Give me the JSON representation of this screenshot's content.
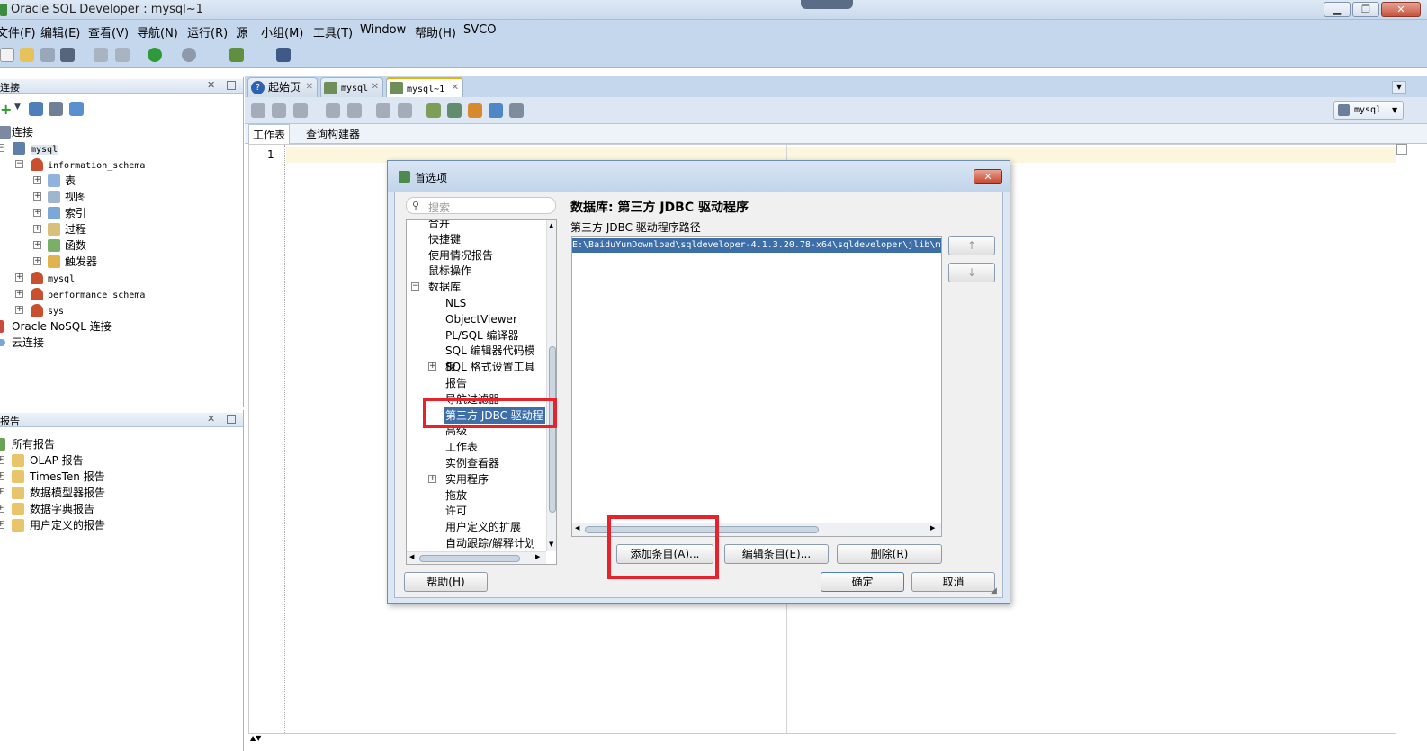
{
  "window": {
    "title": "Oracle SQL Developer : mysql~1",
    "min": "▁",
    "max": "❐",
    "close": "✕"
  },
  "menubar": [
    "文件(F)",
    "编辑(E)",
    "查看(V)",
    "导航(N)",
    "运行(R)",
    "源",
    "小组(M)",
    "工具(T)",
    "Window",
    "帮助(H)",
    "SVCO"
  ],
  "connections_panel": {
    "title": "连接",
    "root": "连接",
    "items": [
      {
        "label": "mysql",
        "level": 1
      },
      {
        "label": "information_schema",
        "level": 2
      },
      {
        "label": "表",
        "level": 3
      },
      {
        "label": "视图",
        "level": 3
      },
      {
        "label": "索引",
        "level": 3
      },
      {
        "label": "过程",
        "level": 3
      },
      {
        "label": "函数",
        "level": 3
      },
      {
        "label": "触发器",
        "level": 3
      },
      {
        "label": "mysql",
        "level": 2
      },
      {
        "label": "performance_schema",
        "level": 2
      },
      {
        "label": "sys",
        "level": 2
      }
    ],
    "nosql": "Oracle NoSQL 连接",
    "cloud": "云连接"
  },
  "reports_panel": {
    "title": "报告",
    "root": "所有报告",
    "items": [
      "OLAP 报告",
      "TimesTen 报告",
      "数据模型器报告",
      "数据字典报告",
      "用户定义的报告"
    ]
  },
  "tabs": [
    {
      "label": "起始页"
    },
    {
      "label": "mysql"
    },
    {
      "label": "mysql~1",
      "active": true
    }
  ],
  "editor": {
    "subtabs": [
      "工作表",
      "查询构建器"
    ],
    "connection_selector": "mysql",
    "line_number": "1"
  },
  "dialog": {
    "title": "首选项",
    "search_placeholder": "搜索",
    "tree": [
      {
        "label": "合并",
        "level": 1
      },
      {
        "label": "快捷键",
        "level": 1
      },
      {
        "label": "使用情况报告",
        "level": 1
      },
      {
        "label": "鼠标操作",
        "level": 1
      },
      {
        "label": "数据库",
        "level": 1,
        "expanded": true
      },
      {
        "label": "NLS",
        "level": 2
      },
      {
        "label": "ObjectViewer",
        "level": 2
      },
      {
        "label": "PL/SQL 编译器",
        "level": 2
      },
      {
        "label": "SQL 编辑器代码模板",
        "level": 2
      },
      {
        "label": "SQL 格式设置工具",
        "level": 2,
        "expandable": true
      },
      {
        "label": "报告",
        "level": 2
      },
      {
        "label": "导航过滤器",
        "level": 2
      },
      {
        "label": "第三方 JDBC 驱动程",
        "level": 2,
        "selected": true
      },
      {
        "label": "高级",
        "level": 2
      },
      {
        "label": "工作表",
        "level": 2
      },
      {
        "label": "实例查看器",
        "level": 2
      },
      {
        "label": "实用程序",
        "level": 2,
        "expandable": true
      },
      {
        "label": "拖放",
        "level": 2
      },
      {
        "label": "许可",
        "level": 2
      },
      {
        "label": "用户定义的扩展",
        "level": 2
      },
      {
        "label": "自动跟踪/解释计划",
        "level": 2
      }
    ],
    "heading": "数据库: 第三方 JDBC 驱动程序",
    "path_label": "第三方 JDBC 驱动程序路径",
    "path_value": "E:\\BaiduYunDownload\\sqldeveloper-4.1.3.20.78-x64\\sqldeveloper\\jlib\\my",
    "move_up": "↑",
    "move_down": "↓",
    "add_button": "添加条目(A)...",
    "edit_button": "编辑条目(E)...",
    "delete_button": "删除(R)",
    "help_button": "帮助(H)",
    "ok_button": "确定",
    "cancel_button": "取消"
  }
}
